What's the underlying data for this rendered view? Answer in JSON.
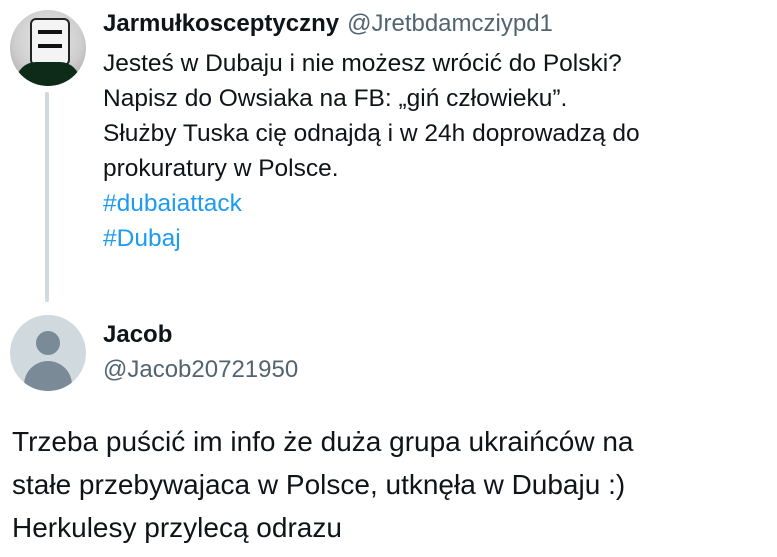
{
  "tweet1": {
    "display_name": "Jarmułkosceptyczny",
    "handle": "@Jretbdamcziypd1",
    "lines": [
      "Jesteś w Dubaju i nie możesz wrócić do Polski?",
      "Napisz do Owsiaka na FB: „giń człowieku”.",
      "Służby Tuska cię odnajdą i w 24h doprowadzą do",
      "prokuratury w Polsce."
    ],
    "hashtags": [
      "#dubaiattack",
      "#Dubaj"
    ]
  },
  "tweet2": {
    "display_name": "Jacob",
    "handle": "@Jacob20721950",
    "lines": [
      "Trzeba puścić im info że duża grupa ukraińców na",
      "stałe przebywajaca w Polsce, utknęła w Dubaju :)",
      "Herkulesy przylecą odrazu"
    ]
  },
  "colors": {
    "text": "#0f1419",
    "secondary": "#536471",
    "link": "#1d9bf0",
    "thread_line": "#cfd9de"
  }
}
